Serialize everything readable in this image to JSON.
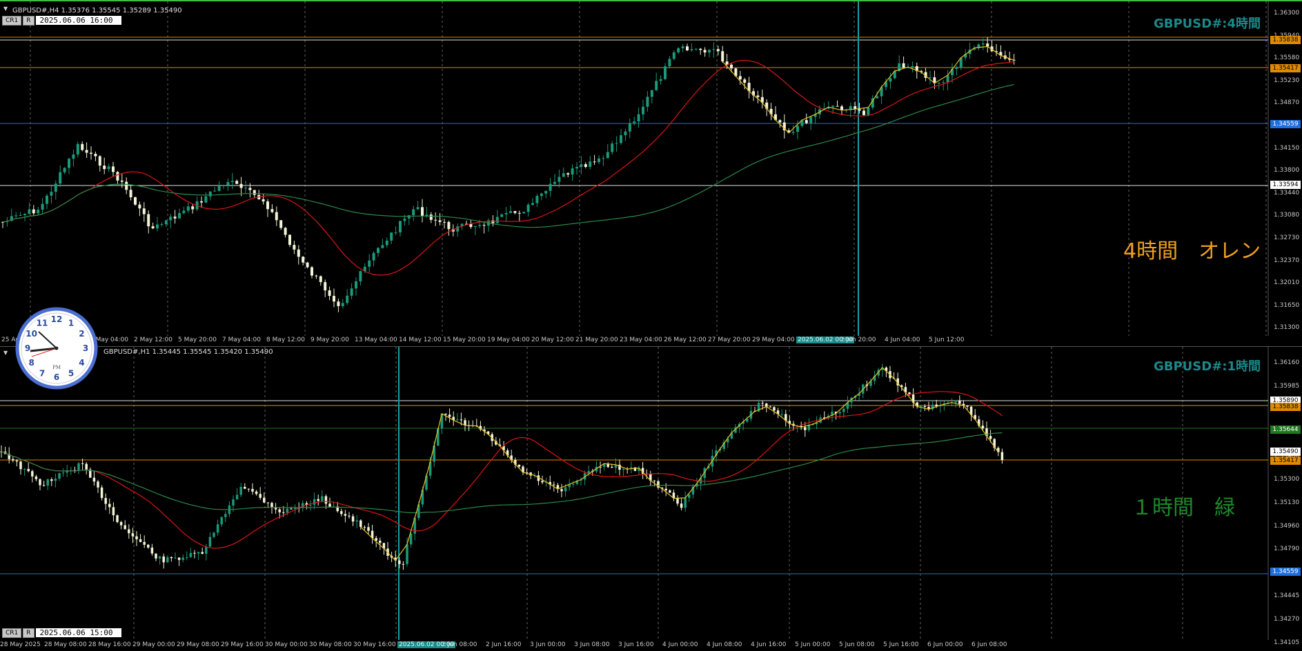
{
  "top": {
    "info": "GBPUSD#,H4  1.35376 1.35545 1.35289 1.35490",
    "btn1": "CR1",
    "btn2": "R",
    "date_box": "2025.06.06 16:00",
    "symbol_label": "GBPUSD#:4時間",
    "big_label": "4時間　オレン",
    "axis": [
      "1.36300",
      "1.35940",
      "1.35580",
      "1.35230",
      "1.34870",
      "1.34510",
      "1.34150",
      "1.33800",
      "1.33440",
      "1.33080",
      "1.32730",
      "1.32370",
      "1.32010",
      "1.31650",
      "1.31300"
    ],
    "tags": [
      {
        "text": "1.35838",
        "bg": "#e08a00",
        "fg": "#000"
      },
      {
        "text": "1.35417",
        "bg": "#e08a00",
        "fg": "#000"
      },
      {
        "text": "1.34559",
        "bg": "#1e6fd9",
        "fg": "#fff"
      },
      {
        "text": "1.33594",
        "bg": "#ffffff",
        "fg": "#000"
      }
    ],
    "times": [
      "25 Apr 2025",
      "Apr 20:00",
      "1 May 04:00",
      "2 May 12:00",
      "5 May 20:00",
      "7 May 04:00",
      "8 May 12:00",
      "9 May 20:00",
      "13 May 04:00",
      "14 May 12:00",
      "15 May 20:00",
      "19 May 04:00",
      "20 May 12:00",
      "21 May 20:00",
      "23 May 04:00",
      "26 May 12:00",
      "27 May 20:00",
      "29 May 04:00",
      "2025.06.02 00:00",
      "2 Jun 20:00",
      "4 Jun 04:00",
      "5 Jun 12:00"
    ]
  },
  "bottom": {
    "info": "GBPUSD#,H1  1.35445 1.35545 1.35420 1.35490",
    "btn1": "CR1",
    "btn2": "R",
    "date_box": "2025.06.06 15:00",
    "symbol_label": "GBPUSD#:1時間",
    "big_label": "１時間　緑",
    "axis": [
      "1.36160",
      "1.35985",
      "1.35810",
      "1.35650",
      "1.35480",
      "1.35300",
      "1.35130",
      "1.34960",
      "1.34790",
      "1.34615",
      "1.34445",
      "1.34270",
      "1.34105"
    ],
    "tags": [
      {
        "text": "1.35890",
        "bg": "#ffffff",
        "fg": "#000"
      },
      {
        "text": "1.35838",
        "bg": "#e08a00",
        "fg": "#000"
      },
      {
        "text": "1.35644",
        "bg": "#1f7a1f",
        "fg": "#fff"
      },
      {
        "text": "1.35490",
        "bg": "#ffffff",
        "fg": "#000"
      },
      {
        "text": "1.35417",
        "bg": "#e08a00",
        "fg": "#000"
      },
      {
        "text": "1.34559",
        "bg": "#1e6fd9",
        "fg": "#fff"
      }
    ],
    "times": [
      "28 May 2025",
      "28 May 08:00",
      "28 May 16:00",
      "29 May 00:00",
      "29 May 08:00",
      "29 May 16:00",
      "30 May 00:00",
      "30 May 08:00",
      "30 May 16:00",
      "2025.06.02 00:00",
      "2 Jun 08:00",
      "2 Jun 16:00",
      "3 Jun 00:00",
      "3 Jun 08:00",
      "3 Jun 16:00",
      "4 Jun 00:00",
      "4 Jun 08:00",
      "4 Jun 16:00",
      "5 Jun 00:00",
      "5 Jun 08:00",
      "5 Jun 16:00",
      "6 Jun 00:00",
      "6 Jun 08:00"
    ]
  },
  "clock": {
    "pm_label": "PM",
    "numbers": [
      "12",
      "1",
      "2",
      "3",
      "4",
      "5",
      "6",
      "7",
      "8",
      "9",
      "10",
      "11"
    ]
  },
  "colors": {
    "bull": "#1a9a7a",
    "bear": "#f4f4d8",
    "ma_fast": "#e01515",
    "ma_slow": "#2a8a4a",
    "zigzag": "#e8c020",
    "orange": "#e08a00",
    "blue": "#1e6fd9",
    "green": "#1f7a1f",
    "cyan": "#1aa0a0"
  }
}
